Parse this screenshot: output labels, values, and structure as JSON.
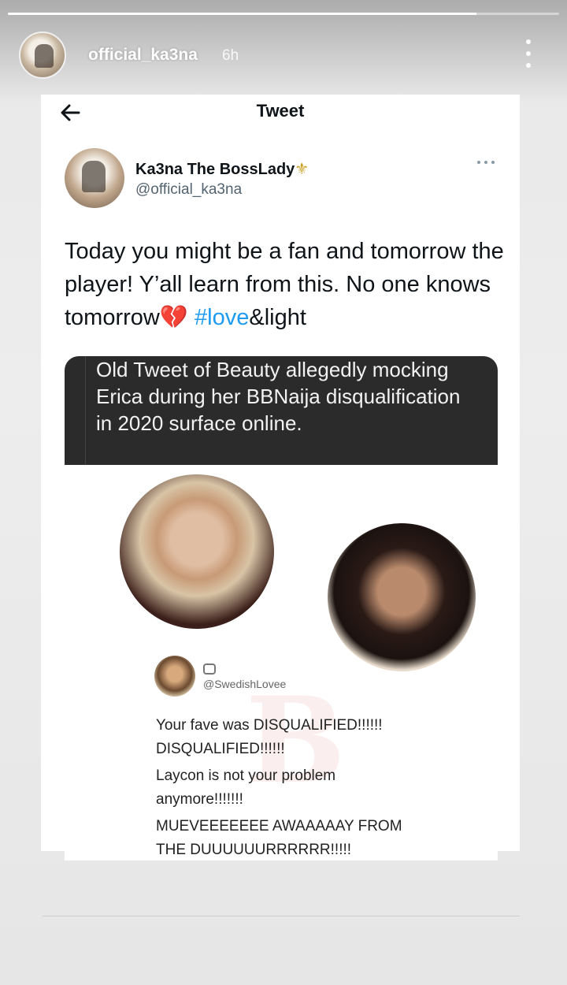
{
  "story": {
    "progress": 0.85,
    "username": "official_ka3na",
    "time": "6h",
    "more_icon": "vertical-dots-icon"
  },
  "tweet_page": {
    "nav": {
      "back_icon": "arrow-left-icon",
      "title": "Tweet"
    },
    "author": {
      "display_name": "Ka3na The BossLady",
      "name_emoji": "⚜",
      "handle": "@official_ka3na"
    },
    "more_icon": "horizontal-dots-icon",
    "text": {
      "body": "Today you might be a fan and tomorrow the player! Y’all learn from this. No one knows tomorrow💔 ",
      "hashtag": "#love",
      "tail": "&light"
    },
    "media": {
      "caption": "Old Tweet of Beauty allegedly mocking Erica during her BBNaija disqualification in 2020 surface online.",
      "embedded_tweet": {
        "handle": "@SwedishLovee",
        "lines": [
          "Your fave was DISQUALIFIED!!!!!!\nDISQUALIFIED!!!!!!",
          "Laycon is not your problem\nanymore!!!!!!!",
          "MUEVEEEEEEE AWAAAAAY FROM\nTHE DUUUUUURRRRRR!!!!!"
        ]
      }
    }
  },
  "colors": {
    "hashtag": "#1d9bf0",
    "caption_bg": "#2b2b2b",
    "text_primary": "#0f1419",
    "text_secondary": "#536471"
  }
}
